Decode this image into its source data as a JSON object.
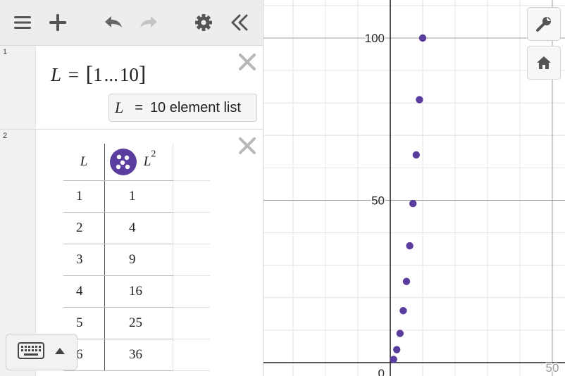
{
  "toolbar": {
    "menu_icon": "hamburger-menu-icon",
    "add_icon": "plus-icon",
    "undo_icon": "undo-icon",
    "redo_icon": "redo-icon",
    "settings_icon": "gear-icon",
    "collapse_icon": "double-chevron-left-icon"
  },
  "expressions": [
    {
      "number": "1",
      "lhs": "L",
      "equals": "=",
      "list_start": "1",
      "ellipsis": "...",
      "list_end": "10",
      "output": {
        "var": "L",
        "equals": "=",
        "text": "10 element list"
      }
    },
    {
      "number": "2",
      "table": {
        "headers": [
          "L",
          "L"
        ],
        "header_exponent": "2",
        "point_style_icon": "scatter-points-icon",
        "rows": [
          [
            "1",
            "1"
          ],
          [
            "2",
            "4"
          ],
          [
            "3",
            "9"
          ],
          [
            "4",
            "16"
          ],
          [
            "5",
            "25"
          ],
          [
            "6",
            "36"
          ]
        ]
      }
    }
  ],
  "graph": {
    "y_ticks": [
      "100",
      "50",
      "0"
    ],
    "x_ticks": [
      "50"
    ],
    "point_color": "#5a3d9e",
    "grid_visible": true
  },
  "chart_data": {
    "type": "scatter",
    "x": [
      1,
      2,
      3,
      4,
      5,
      6,
      7,
      8,
      9,
      10
    ],
    "y": [
      1,
      4,
      9,
      16,
      25,
      36,
      49,
      64,
      81,
      100
    ],
    "xlim": [
      -40,
      55
    ],
    "ylim": [
      -3,
      115
    ],
    "grid": true,
    "series": [
      {
        "values": [
          1,
          4,
          9,
          16,
          25,
          36,
          49,
          64,
          81,
          100
        ]
      }
    ]
  },
  "buttons": {
    "settings_wrench_icon": "wrench-icon",
    "home_icon": "home-icon",
    "keyboard_icon": "keyboard-icon",
    "keyboard_toggle_icon": "triangle-up-icon"
  }
}
